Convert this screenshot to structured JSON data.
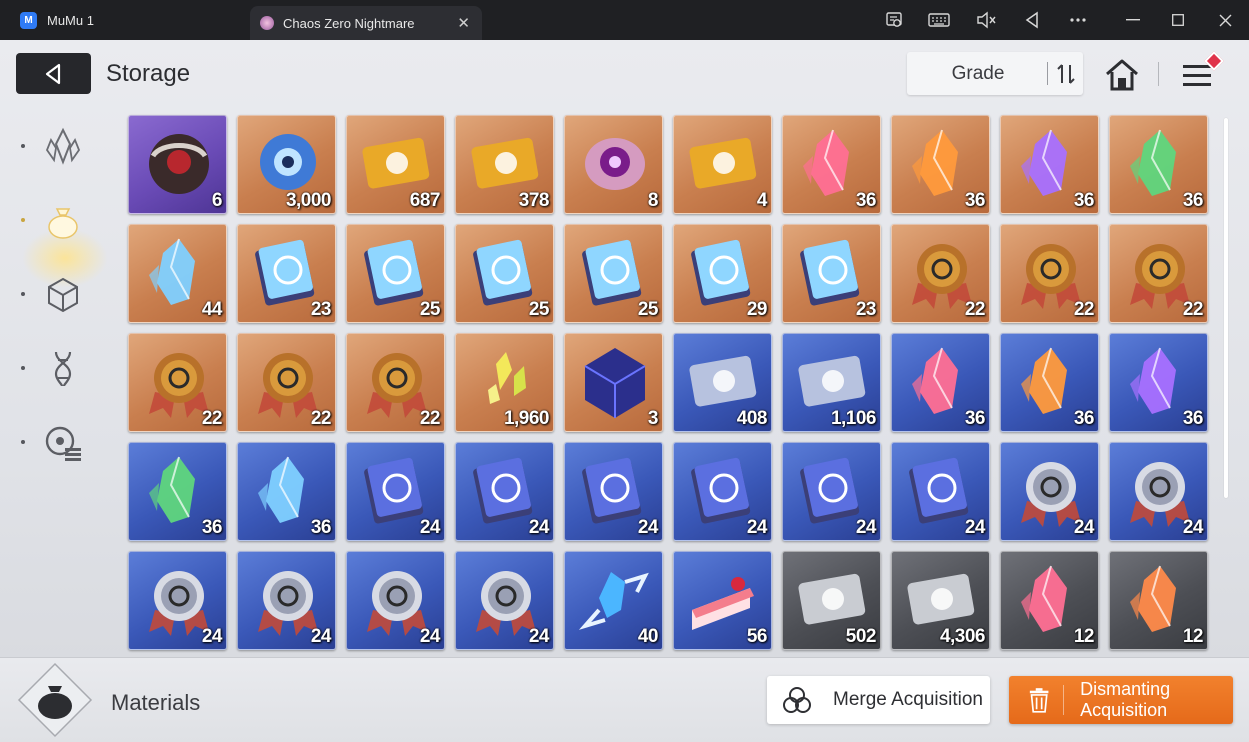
{
  "window": {
    "app_name": "MuMu 1",
    "app_logo_letter": "M",
    "tab_title": "Chaos Zero Nightmare",
    "tab_close": "✕",
    "controls": [
      "guide-icon",
      "keyboard-icon",
      "mute-icon",
      "back-nav-icon",
      "more-icon",
      "minimize-icon",
      "maximize-icon",
      "close-icon"
    ]
  },
  "header": {
    "title": "Storage",
    "sort_label": "Grade"
  },
  "rail": {
    "items": [
      "crystal-category-icon",
      "bag-category-icon",
      "cube-category-icon",
      "dna-category-icon",
      "gear-list-category-icon"
    ],
    "active_index": 1
  },
  "items": [
    {
      "icon": "dark-orb-relic",
      "grade": "purple",
      "qty": "6"
    },
    {
      "icon": "blue-eye-creature",
      "grade": "orange",
      "qty": "3,000"
    },
    {
      "icon": "gold-ticket",
      "grade": "orange",
      "qty": "687"
    },
    {
      "icon": "gold-star-ticket",
      "grade": "orange",
      "qty": "378"
    },
    {
      "icon": "purple-eye-blob",
      "grade": "orange",
      "qty": "8"
    },
    {
      "icon": "golden-feather",
      "grade": "orange",
      "qty": "4"
    },
    {
      "icon": "pink-crystal",
      "grade": "orange",
      "qty": "36"
    },
    {
      "icon": "amber-crystal",
      "grade": "orange",
      "qty": "36"
    },
    {
      "icon": "purple-crystal",
      "grade": "orange",
      "qty": "36"
    },
    {
      "icon": "green-crystal",
      "grade": "orange",
      "qty": "36"
    },
    {
      "icon": "blue-crystal",
      "grade": "orange",
      "qty": "44"
    },
    {
      "icon": "skill-book-swords",
      "grade": "orange",
      "qty": "23"
    },
    {
      "icon": "skill-book-shield",
      "grade": "orange",
      "qty": "25"
    },
    {
      "icon": "skill-book-eye",
      "grade": "orange",
      "qty": "25"
    },
    {
      "icon": "skill-book-wing",
      "grade": "orange",
      "qty": "25"
    },
    {
      "icon": "skill-book-bolt",
      "grade": "orange",
      "qty": "29"
    },
    {
      "icon": "skill-book-orb",
      "grade": "orange",
      "qty": "23"
    },
    {
      "icon": "medal-sword",
      "grade": "orange",
      "qty": "22"
    },
    {
      "icon": "medal-shield",
      "grade": "orange",
      "qty": "22"
    },
    {
      "icon": "medal-eye",
      "grade": "orange",
      "qty": "22"
    },
    {
      "icon": "medal-wing",
      "grade": "orange",
      "qty": "22"
    },
    {
      "icon": "medal-bolt",
      "grade": "orange",
      "qty": "22"
    },
    {
      "icon": "medal-orb",
      "grade": "orange",
      "qty": "22"
    },
    {
      "icon": "yellow-shards",
      "grade": "orange",
      "qty": "1,960"
    },
    {
      "icon": "dark-cube",
      "grade": "orange",
      "qty": "3"
    },
    {
      "icon": "silver-ticket",
      "grade": "blue",
      "qty": "408"
    },
    {
      "icon": "silver-star-ticket",
      "grade": "blue",
      "qty": "1,106"
    },
    {
      "icon": "pink-crystal-small",
      "grade": "blue",
      "qty": "36"
    },
    {
      "icon": "amber-crystal-small",
      "grade": "blue",
      "qty": "36"
    },
    {
      "icon": "purple-crystal-small",
      "grade": "blue",
      "qty": "36"
    },
    {
      "icon": "green-crystal-small",
      "grade": "blue",
      "qty": "36"
    },
    {
      "icon": "blue-crystal-small",
      "grade": "blue",
      "qty": "36"
    },
    {
      "icon": "blue-book-swords",
      "grade": "blue",
      "qty": "24"
    },
    {
      "icon": "blue-book-shield",
      "grade": "blue",
      "qty": "24"
    },
    {
      "icon": "blue-book-eye",
      "grade": "blue",
      "qty": "24"
    },
    {
      "icon": "blue-book-wing",
      "grade": "blue",
      "qty": "24"
    },
    {
      "icon": "blue-book-bolt",
      "grade": "blue",
      "qty": "24"
    },
    {
      "icon": "blue-book-orb",
      "grade": "blue",
      "qty": "24"
    },
    {
      "icon": "silver-medal-sword",
      "grade": "blue",
      "qty": "24"
    },
    {
      "icon": "silver-medal-shield",
      "grade": "blue",
      "qty": "24"
    },
    {
      "icon": "silver-medal-eye",
      "grade": "blue",
      "qty": "24"
    },
    {
      "icon": "silver-medal-wing",
      "grade": "blue",
      "qty": "24"
    },
    {
      "icon": "silver-medal-bolt",
      "grade": "blue",
      "qty": "24"
    },
    {
      "icon": "silver-medal-orb",
      "grade": "blue",
      "qty": "24"
    },
    {
      "icon": "ice-shard-burst",
      "grade": "blue",
      "qty": "40"
    },
    {
      "icon": "strawberry-cake",
      "grade": "blue",
      "qty": "56"
    },
    {
      "icon": "gray-ticket",
      "grade": "gray",
      "qty": "502"
    },
    {
      "icon": "gray-star-ticket",
      "grade": "gray",
      "qty": "4,306"
    },
    {
      "icon": "pink-fragment",
      "grade": "gray",
      "qty": "12"
    },
    {
      "icon": "orange-fragment",
      "grade": "gray",
      "qty": "12"
    }
  ],
  "footer": {
    "category_label": "Materials",
    "merge_label": "Merge Acquisition",
    "dismantle_label": "Dismanting Acquisition"
  },
  "colors": {
    "accent_orange": "#e56a1a",
    "grade_orange": "#c97f4f",
    "grade_blue": "#3a58b8",
    "grade_purple": "#6a4bb6",
    "grade_gray": "#4d4f55",
    "badge_red": "#e0334a"
  }
}
